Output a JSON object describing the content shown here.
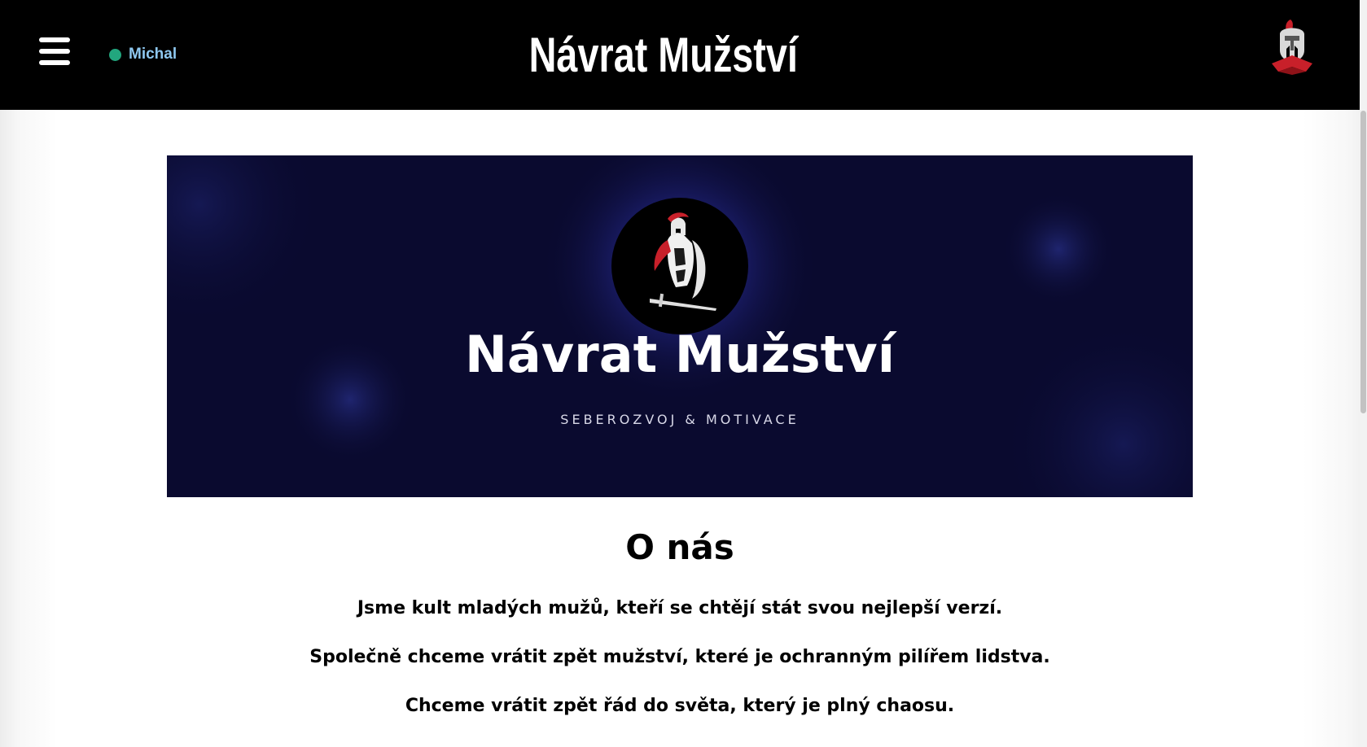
{
  "header": {
    "user_name": "Michal",
    "title": "Návrat Mužství",
    "status_color": "#22a67e",
    "menu_icon": "hamburger-menu-icon",
    "logo_icon": "spartan-helmet-icon"
  },
  "banner": {
    "heading": "Návrat Mužství",
    "tagline": "SEBEROZVOJ & MOTIVACE",
    "emblem_icon": "spartan-warrior-icon",
    "background_color": "#0a0a2f"
  },
  "about": {
    "heading": "O nás",
    "paragraphs": [
      "Jsme kult mladých mužů, kteří se chtějí stát svou nejlepší verzí.",
      "Společně chceme vrátit zpět mužství, které je ochranným pilířem lidstva.",
      "Chceme vrátit zpět řád do světa, který je plný chaosu."
    ]
  }
}
